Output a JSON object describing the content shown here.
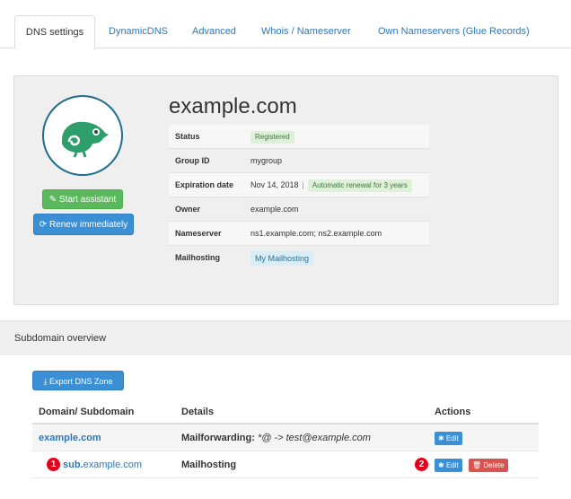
{
  "tabs": [
    {
      "label": "DNS settings",
      "active": true
    },
    {
      "label": "DynamicDNS",
      "active": false
    },
    {
      "label": "Advanced",
      "active": false
    },
    {
      "label": "Whois / Nameserver",
      "active": false
    },
    {
      "label": "Own Nameservers (Glue Records)",
      "active": false
    }
  ],
  "domain": {
    "name": "example.com",
    "logo_icon": "chameleon-logo-icon",
    "start_assistant_label": "Start assistant",
    "renew_label": "Renew immediately",
    "details": {
      "status_label": "Status",
      "status_value": "Registered",
      "group_label": "Group ID",
      "group_value": "mygroup",
      "expiration_label": "Expiration date",
      "expiration_value": "Nov 14, 2018",
      "expiration_sep": "|",
      "renewal_badge": "Automatic renewal for 3 years",
      "owner_label": "Owner",
      "owner_value": "example.com",
      "nameserver_label": "Nameserver",
      "nameserver_value": "ns1.example.com; ns2.example.com",
      "mailhosting_label": "Mailhosting",
      "mailhosting_value": "My Mailhosting"
    }
  },
  "subdomains": {
    "section_title": "Subdomain overview",
    "export_label": "Export DNS Zone",
    "columns": {
      "domain": "Domain/ Subdomain",
      "details": "Details",
      "actions": "Actions"
    },
    "rows": [
      {
        "domain": "example.com",
        "details_bold": "Mailforwarding:",
        "details_italic": "*@ -> test@example.com",
        "edit_label": "Edit"
      },
      {
        "marker": "1",
        "domain_sub": "sub.",
        "domain_rest": "example.com",
        "details_bold": "Mailhosting",
        "marker2": "2",
        "edit_label": "Edit",
        "delete_label": "Delete"
      }
    ]
  },
  "colors": {
    "link_blue": "#2f77b6",
    "button_blue": "#3b8fd5",
    "button_green": "#5cb85c",
    "button_red": "#d9534f",
    "marker_red": "#e3001b",
    "logo_green": "#2e9e6a"
  }
}
